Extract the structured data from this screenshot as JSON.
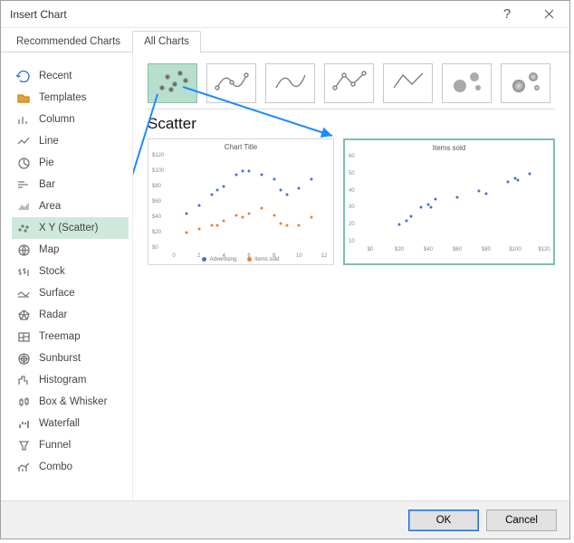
{
  "dialog": {
    "title": "Insert Chart"
  },
  "tabs": {
    "recommended": "Recommended Charts",
    "all": "All Charts",
    "active": "all"
  },
  "nav": [
    {
      "label": "Recent",
      "icon": "recent"
    },
    {
      "label": "Templates",
      "icon": "templates"
    },
    {
      "label": "Column",
      "icon": "column"
    },
    {
      "label": "Line",
      "icon": "line"
    },
    {
      "label": "Pie",
      "icon": "pie"
    },
    {
      "label": "Bar",
      "icon": "bar"
    },
    {
      "label": "Area",
      "icon": "area"
    },
    {
      "label": "X Y (Scatter)",
      "icon": "scatter",
      "selected": true
    },
    {
      "label": "Map",
      "icon": "map"
    },
    {
      "label": "Stock",
      "icon": "stock"
    },
    {
      "label": "Surface",
      "icon": "surface"
    },
    {
      "label": "Radar",
      "icon": "radar"
    },
    {
      "label": "Treemap",
      "icon": "treemap"
    },
    {
      "label": "Sunburst",
      "icon": "sunburst"
    },
    {
      "label": "Histogram",
      "icon": "histogram"
    },
    {
      "label": "Box & Whisker",
      "icon": "boxwhisker"
    },
    {
      "label": "Waterfall",
      "icon": "waterfall"
    },
    {
      "label": "Funnel",
      "icon": "funnel"
    },
    {
      "label": "Combo",
      "icon": "combo"
    }
  ],
  "subtypes": [
    "scatter",
    "scatter-smooth-markers",
    "scatter-smooth",
    "scatter-lines-markers",
    "scatter-lines",
    "bubble",
    "bubble-3d"
  ],
  "section_title": "Scatter",
  "preview1": {
    "title": "Chart Title",
    "legend": [
      "Advertising",
      "Items sold"
    ]
  },
  "preview2": {
    "title": "Items sold"
  },
  "buttons": {
    "ok": "OK",
    "cancel": "Cancel"
  },
  "chart_data": [
    {
      "type": "scatter",
      "title": "Chart Title",
      "xlabel": "",
      "ylabel": "",
      "xlim": [
        0,
        12
      ],
      "ylim": [
        0,
        120
      ],
      "xticks": [
        0,
        2,
        4,
        6,
        8,
        10,
        12
      ],
      "yticks": [
        "$0",
        "$20",
        "$40",
        "$60",
        "$80",
        "$100",
        "$120"
      ],
      "series": [
        {
          "name": "Advertising",
          "color": "#4472c4",
          "points": [
            [
              1,
              45
            ],
            [
              2,
              55
            ],
            [
              3,
              70
            ],
            [
              3.5,
              75
            ],
            [
              4,
              80
            ],
            [
              5,
              95
            ],
            [
              5.5,
              100
            ],
            [
              6,
              100
            ],
            [
              7,
              95
            ],
            [
              8,
              90
            ],
            [
              8.5,
              75
            ],
            [
              9,
              70
            ],
            [
              10,
              78
            ],
            [
              11,
              90
            ]
          ]
        },
        {
          "name": "Items sold",
          "color": "#ed7d31",
          "points": [
            [
              1,
              20
            ],
            [
              2,
              25
            ],
            [
              3,
              30
            ],
            [
              3.5,
              30
            ],
            [
              4,
              35
            ],
            [
              5,
              42
            ],
            [
              5.5,
              40
            ],
            [
              6,
              45
            ],
            [
              7,
              52
            ],
            [
              8,
              42
            ],
            [
              8.5,
              32
            ],
            [
              9,
              30
            ],
            [
              10,
              30
            ],
            [
              11,
              40
            ]
          ]
        }
      ]
    },
    {
      "type": "scatter",
      "title": "Items sold",
      "xlabel": "",
      "ylabel": "",
      "xlim": [
        0,
        120
      ],
      "ylim": [
        10,
        60
      ],
      "xticks": [
        "$0",
        "$20",
        "$40",
        "$60",
        "$80",
        "$100",
        "$120"
      ],
      "yticks": [
        10,
        20,
        30,
        40,
        50,
        60
      ],
      "series": [
        {
          "name": "Items sold",
          "color": "#4472c4",
          "points": [
            [
              20,
              20
            ],
            [
              25,
              22
            ],
            [
              28,
              25
            ],
            [
              35,
              30
            ],
            [
              42,
              30
            ],
            [
              40,
              32
            ],
            [
              45,
              35
            ],
            [
              60,
              36
            ],
            [
              75,
              40
            ],
            [
              80,
              38
            ],
            [
              95,
              45
            ],
            [
              100,
              47
            ],
            [
              102,
              46
            ],
            [
              110,
              50
            ]
          ]
        }
      ]
    }
  ]
}
